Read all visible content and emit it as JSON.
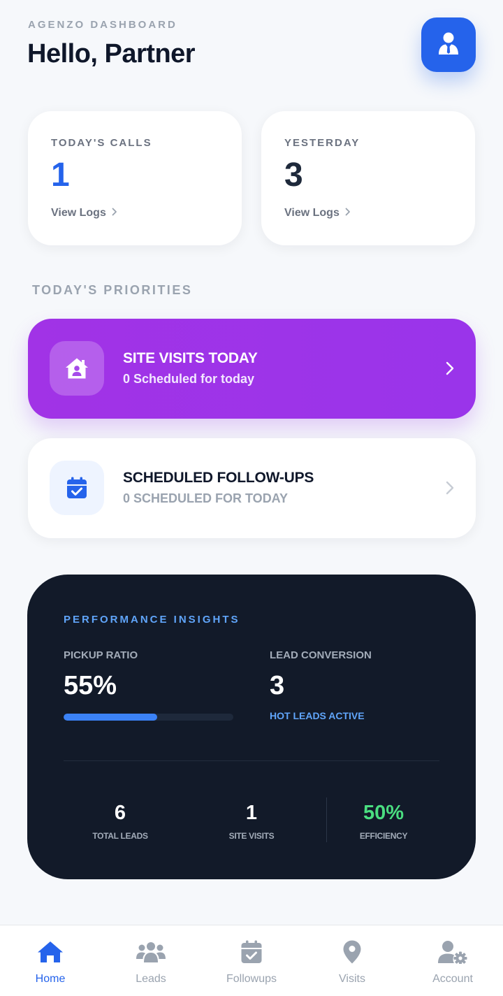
{
  "header": {
    "eyebrow": "AGENZO DASHBOARD",
    "greeting": "Hello, Partner",
    "avatar_icon": "user-tie-icon"
  },
  "stats": [
    {
      "label": "TODAY'S CALLS",
      "value": "1",
      "link": "View Logs",
      "accent": "#2563eb"
    },
    {
      "label": "YESTERDAY",
      "value": "3",
      "link": "View Logs",
      "accent": "#1e293b"
    }
  ],
  "priorities": {
    "title": "TODAY'S PRIORITIES",
    "site_visits": {
      "title": "SITE VISITS TODAY",
      "subtitle": "0 Scheduled for today",
      "icon": "house-user-icon",
      "color": "#9b34e8"
    },
    "followups": {
      "title": "SCHEDULED FOLLOW-UPS",
      "subtitle": "0 SCHEDULED FOR TODAY",
      "icon": "calendar-check-icon",
      "color": "#2563eb"
    }
  },
  "insights": {
    "title": "PERFORMANCE INSIGHTS",
    "pickup_ratio": {
      "label": "PICKUP RATIO",
      "value": "55%",
      "progress": 0.55
    },
    "lead_conversion": {
      "label": "LEAD CONVERSION",
      "value": "3",
      "note": "HOT LEADS ACTIVE"
    },
    "totals": [
      {
        "value": "6",
        "label": "TOTAL LEADS"
      },
      {
        "value": "1",
        "label": "SITE VISITS"
      },
      {
        "value": "50%",
        "label": "EFFICIENCY",
        "color": "#4ade80"
      }
    ]
  },
  "nav": {
    "active": "Home",
    "items": [
      {
        "label": "Home",
        "icon": "home-icon"
      },
      {
        "label": "Leads",
        "icon": "users-icon"
      },
      {
        "label": "Followups",
        "icon": "calendar-check-icon"
      },
      {
        "label": "Visits",
        "icon": "map-pin-icon"
      },
      {
        "label": "Account",
        "icon": "user-gear-icon"
      }
    ]
  }
}
